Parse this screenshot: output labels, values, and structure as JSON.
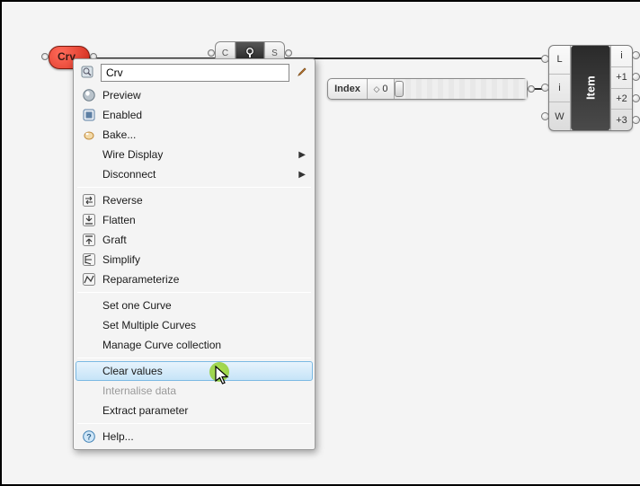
{
  "crv_node": {
    "label": "Crv"
  },
  "capsule": {
    "left_label": "C",
    "right_label": "S"
  },
  "index_slider": {
    "label": "Index",
    "value": "0"
  },
  "list_item_node": {
    "title": "Item",
    "inputs": [
      "L",
      "i",
      "W"
    ],
    "outputs": [
      "i",
      "+1",
      "+2",
      "+3"
    ]
  },
  "context_menu": {
    "search_value": "Crv",
    "items": [
      {
        "label": "Preview",
        "icon": "preview-icon",
        "submenu": false
      },
      {
        "label": "Enabled",
        "icon": "enabled-icon",
        "submenu": false
      },
      {
        "label": "Bake...",
        "icon": "bake-icon",
        "submenu": false
      },
      {
        "label": "Wire Display",
        "icon": "",
        "submenu": true
      },
      {
        "label": "Disconnect",
        "icon": "",
        "submenu": true
      }
    ],
    "items2": [
      {
        "label": "Reverse",
        "icon": "reverse-icon"
      },
      {
        "label": "Flatten",
        "icon": "flatten-icon"
      },
      {
        "label": "Graft",
        "icon": "graft-icon"
      },
      {
        "label": "Simplify",
        "icon": "simplify-icon"
      },
      {
        "label": "Reparameterize",
        "icon": "reparam-icon"
      }
    ],
    "items3": [
      {
        "label": "Set one Curve"
      },
      {
        "label": "Set Multiple Curves"
      },
      {
        "label": "Manage Curve collection"
      }
    ],
    "items4": [
      {
        "label": "Clear values",
        "hover": true
      },
      {
        "label": "Internalise data",
        "disabled": true
      },
      {
        "label": "Extract parameter"
      }
    ],
    "items5": [
      {
        "label": "Help...",
        "icon": "help-icon"
      }
    ]
  }
}
